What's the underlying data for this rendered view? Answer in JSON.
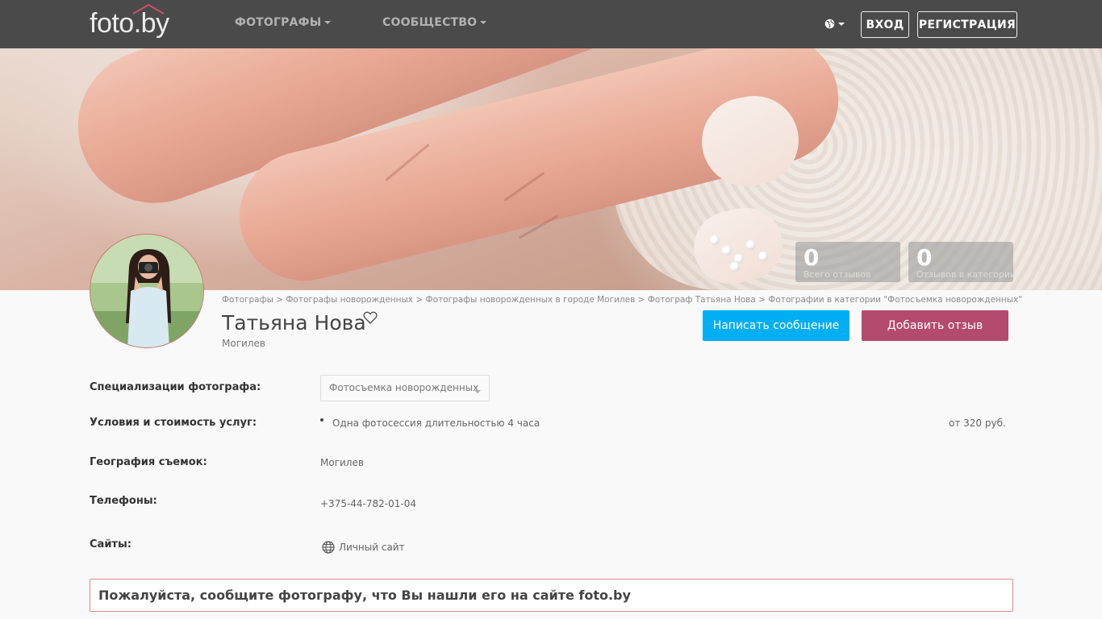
{
  "header": {
    "logo_text": "foto.by",
    "nav": [
      {
        "label": "ФОТОГРАФЫ"
      },
      {
        "label": "СООБЩЕСТВО"
      }
    ],
    "language_icon": "globe-icon",
    "login_label": "ВХОД",
    "register_label": "РЕГИСТРАЦИЯ"
  },
  "stats": [
    {
      "value": "0",
      "label": "Всего отзывов"
    },
    {
      "value": "0",
      "label": "Отзывов в категории"
    }
  ],
  "breadcrumb": [
    "Фотографы",
    "Фотографы новорожденных",
    "Фотографы новорожденных в городе Могилев",
    "Фотограф Татьяна Нова",
    "Фотографии в категории \"Фотосъемка новорожденных\""
  ],
  "breadcrumb_separator": ">",
  "profile": {
    "name": "Татьяна Нова",
    "city": "Могилев",
    "favorite_icon": "heart-icon",
    "message_button": "Написать сообщение",
    "review_button": "Добавить отзыв"
  },
  "details": {
    "specializations_label": "Специализации фотографа:",
    "specialization_selected": "Фотосъемка новорожденных",
    "services_label": "Условия и стоимость услуг:",
    "service_item": "Одна фотосессия длительностью 4 часа",
    "service_price": "от 320 руб.",
    "geography_label": "География съемок:",
    "geography_value": "Могилев",
    "phones_label": "Телефоны:",
    "phone_value": "+375-44-782-01-04",
    "sites_label": "Сайты:",
    "site_link": "Личный сайт"
  },
  "notice": "Пожалуйста, сообщите фотографу, что Вы нашли его на сайте foto.by",
  "colors": {
    "navbar": "#4a4a4a",
    "message_button": "#00aef4",
    "review_button": "#b44a6e",
    "notice_border": "#e08a8a"
  }
}
